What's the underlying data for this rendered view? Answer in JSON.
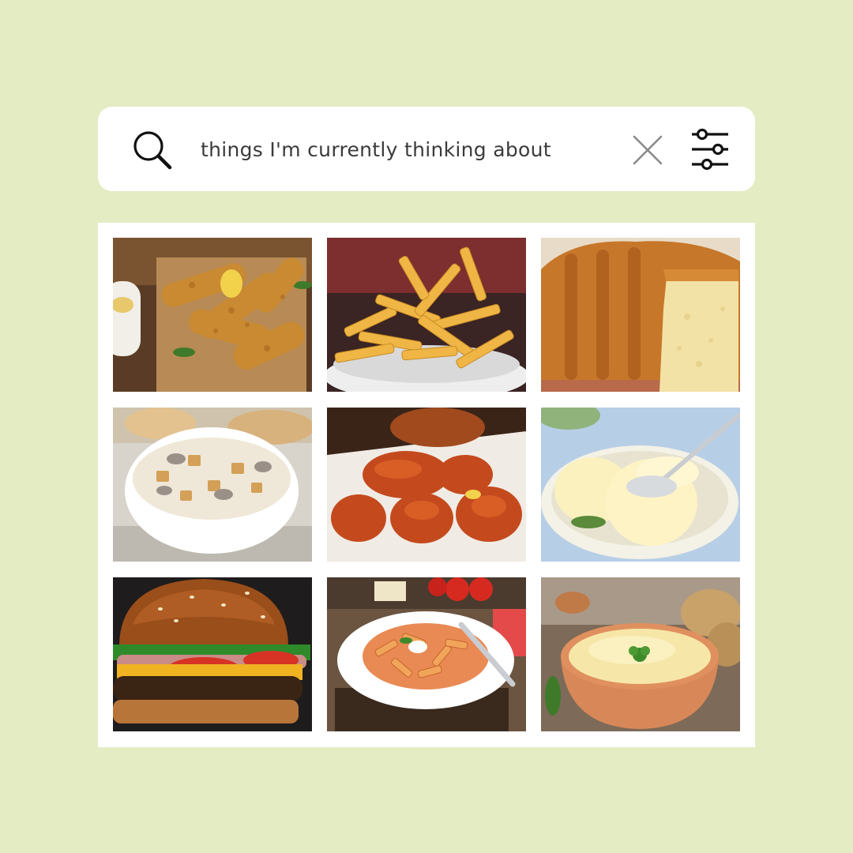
{
  "search": {
    "query": "things I'm currently thinking about",
    "icons": {
      "search": "search-icon",
      "clear": "close-icon",
      "filter": "sliders-icon"
    }
  },
  "results": {
    "items": [
      {
        "name": "chicken-tenders"
      },
      {
        "name": "french-fries"
      },
      {
        "name": "pound-cake"
      },
      {
        "name": "clam-chowder"
      },
      {
        "name": "buffalo-wings"
      },
      {
        "name": "vanilla-ice-cream"
      },
      {
        "name": "cheeseburger"
      },
      {
        "name": "penne-pasta"
      },
      {
        "name": "mashed-potatoes"
      }
    ]
  },
  "colors": {
    "background": "#e4ecc4",
    "card": "#ffffff",
    "text": "#3b3b3b",
    "icon": "#111111",
    "clear": "#8a8a8a"
  }
}
